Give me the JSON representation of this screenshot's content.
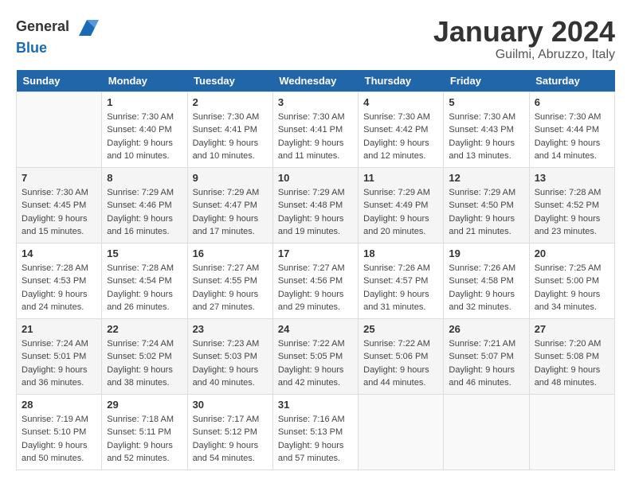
{
  "header": {
    "logo_general": "General",
    "logo_blue": "Blue",
    "month_title": "January 2024",
    "location": "Guilmi, Abruzzo, Italy"
  },
  "days_of_week": [
    "Sunday",
    "Monday",
    "Tuesday",
    "Wednesday",
    "Thursday",
    "Friday",
    "Saturday"
  ],
  "weeks": [
    [
      {
        "day": "",
        "sunrise": "",
        "sunset": "",
        "daylight": ""
      },
      {
        "day": "1",
        "sunrise": "Sunrise: 7:30 AM",
        "sunset": "Sunset: 4:40 PM",
        "daylight": "Daylight: 9 hours and 10 minutes."
      },
      {
        "day": "2",
        "sunrise": "Sunrise: 7:30 AM",
        "sunset": "Sunset: 4:41 PM",
        "daylight": "Daylight: 9 hours and 10 minutes."
      },
      {
        "day": "3",
        "sunrise": "Sunrise: 7:30 AM",
        "sunset": "Sunset: 4:41 PM",
        "daylight": "Daylight: 9 hours and 11 minutes."
      },
      {
        "day": "4",
        "sunrise": "Sunrise: 7:30 AM",
        "sunset": "Sunset: 4:42 PM",
        "daylight": "Daylight: 9 hours and 12 minutes."
      },
      {
        "day": "5",
        "sunrise": "Sunrise: 7:30 AM",
        "sunset": "Sunset: 4:43 PM",
        "daylight": "Daylight: 9 hours and 13 minutes."
      },
      {
        "day": "6",
        "sunrise": "Sunrise: 7:30 AM",
        "sunset": "Sunset: 4:44 PM",
        "daylight": "Daylight: 9 hours and 14 minutes."
      }
    ],
    [
      {
        "day": "7",
        "sunrise": "Sunrise: 7:30 AM",
        "sunset": "Sunset: 4:45 PM",
        "daylight": "Daylight: 9 hours and 15 minutes."
      },
      {
        "day": "8",
        "sunrise": "Sunrise: 7:29 AM",
        "sunset": "Sunset: 4:46 PM",
        "daylight": "Daylight: 9 hours and 16 minutes."
      },
      {
        "day": "9",
        "sunrise": "Sunrise: 7:29 AM",
        "sunset": "Sunset: 4:47 PM",
        "daylight": "Daylight: 9 hours and 17 minutes."
      },
      {
        "day": "10",
        "sunrise": "Sunrise: 7:29 AM",
        "sunset": "Sunset: 4:48 PM",
        "daylight": "Daylight: 9 hours and 19 minutes."
      },
      {
        "day": "11",
        "sunrise": "Sunrise: 7:29 AM",
        "sunset": "Sunset: 4:49 PM",
        "daylight": "Daylight: 9 hours and 20 minutes."
      },
      {
        "day": "12",
        "sunrise": "Sunrise: 7:29 AM",
        "sunset": "Sunset: 4:50 PM",
        "daylight": "Daylight: 9 hours and 21 minutes."
      },
      {
        "day": "13",
        "sunrise": "Sunrise: 7:28 AM",
        "sunset": "Sunset: 4:52 PM",
        "daylight": "Daylight: 9 hours and 23 minutes."
      }
    ],
    [
      {
        "day": "14",
        "sunrise": "Sunrise: 7:28 AM",
        "sunset": "Sunset: 4:53 PM",
        "daylight": "Daylight: 9 hours and 24 minutes."
      },
      {
        "day": "15",
        "sunrise": "Sunrise: 7:28 AM",
        "sunset": "Sunset: 4:54 PM",
        "daylight": "Daylight: 9 hours and 26 minutes."
      },
      {
        "day": "16",
        "sunrise": "Sunrise: 7:27 AM",
        "sunset": "Sunset: 4:55 PM",
        "daylight": "Daylight: 9 hours and 27 minutes."
      },
      {
        "day": "17",
        "sunrise": "Sunrise: 7:27 AM",
        "sunset": "Sunset: 4:56 PM",
        "daylight": "Daylight: 9 hours and 29 minutes."
      },
      {
        "day": "18",
        "sunrise": "Sunrise: 7:26 AM",
        "sunset": "Sunset: 4:57 PM",
        "daylight": "Daylight: 9 hours and 31 minutes."
      },
      {
        "day": "19",
        "sunrise": "Sunrise: 7:26 AM",
        "sunset": "Sunset: 4:58 PM",
        "daylight": "Daylight: 9 hours and 32 minutes."
      },
      {
        "day": "20",
        "sunrise": "Sunrise: 7:25 AM",
        "sunset": "Sunset: 5:00 PM",
        "daylight": "Daylight: 9 hours and 34 minutes."
      }
    ],
    [
      {
        "day": "21",
        "sunrise": "Sunrise: 7:24 AM",
        "sunset": "Sunset: 5:01 PM",
        "daylight": "Daylight: 9 hours and 36 minutes."
      },
      {
        "day": "22",
        "sunrise": "Sunrise: 7:24 AM",
        "sunset": "Sunset: 5:02 PM",
        "daylight": "Daylight: 9 hours and 38 minutes."
      },
      {
        "day": "23",
        "sunrise": "Sunrise: 7:23 AM",
        "sunset": "Sunset: 5:03 PM",
        "daylight": "Daylight: 9 hours and 40 minutes."
      },
      {
        "day": "24",
        "sunrise": "Sunrise: 7:22 AM",
        "sunset": "Sunset: 5:05 PM",
        "daylight": "Daylight: 9 hours and 42 minutes."
      },
      {
        "day": "25",
        "sunrise": "Sunrise: 7:22 AM",
        "sunset": "Sunset: 5:06 PM",
        "daylight": "Daylight: 9 hours and 44 minutes."
      },
      {
        "day": "26",
        "sunrise": "Sunrise: 7:21 AM",
        "sunset": "Sunset: 5:07 PM",
        "daylight": "Daylight: 9 hours and 46 minutes."
      },
      {
        "day": "27",
        "sunrise": "Sunrise: 7:20 AM",
        "sunset": "Sunset: 5:08 PM",
        "daylight": "Daylight: 9 hours and 48 minutes."
      }
    ],
    [
      {
        "day": "28",
        "sunrise": "Sunrise: 7:19 AM",
        "sunset": "Sunset: 5:10 PM",
        "daylight": "Daylight: 9 hours and 50 minutes."
      },
      {
        "day": "29",
        "sunrise": "Sunrise: 7:18 AM",
        "sunset": "Sunset: 5:11 PM",
        "daylight": "Daylight: 9 hours and 52 minutes."
      },
      {
        "day": "30",
        "sunrise": "Sunrise: 7:17 AM",
        "sunset": "Sunset: 5:12 PM",
        "daylight": "Daylight: 9 hours and 54 minutes."
      },
      {
        "day": "31",
        "sunrise": "Sunrise: 7:16 AM",
        "sunset": "Sunset: 5:13 PM",
        "daylight": "Daylight: 9 hours and 57 minutes."
      },
      {
        "day": "",
        "sunrise": "",
        "sunset": "",
        "daylight": ""
      },
      {
        "day": "",
        "sunrise": "",
        "sunset": "",
        "daylight": ""
      },
      {
        "day": "",
        "sunrise": "",
        "sunset": "",
        "daylight": ""
      }
    ]
  ]
}
